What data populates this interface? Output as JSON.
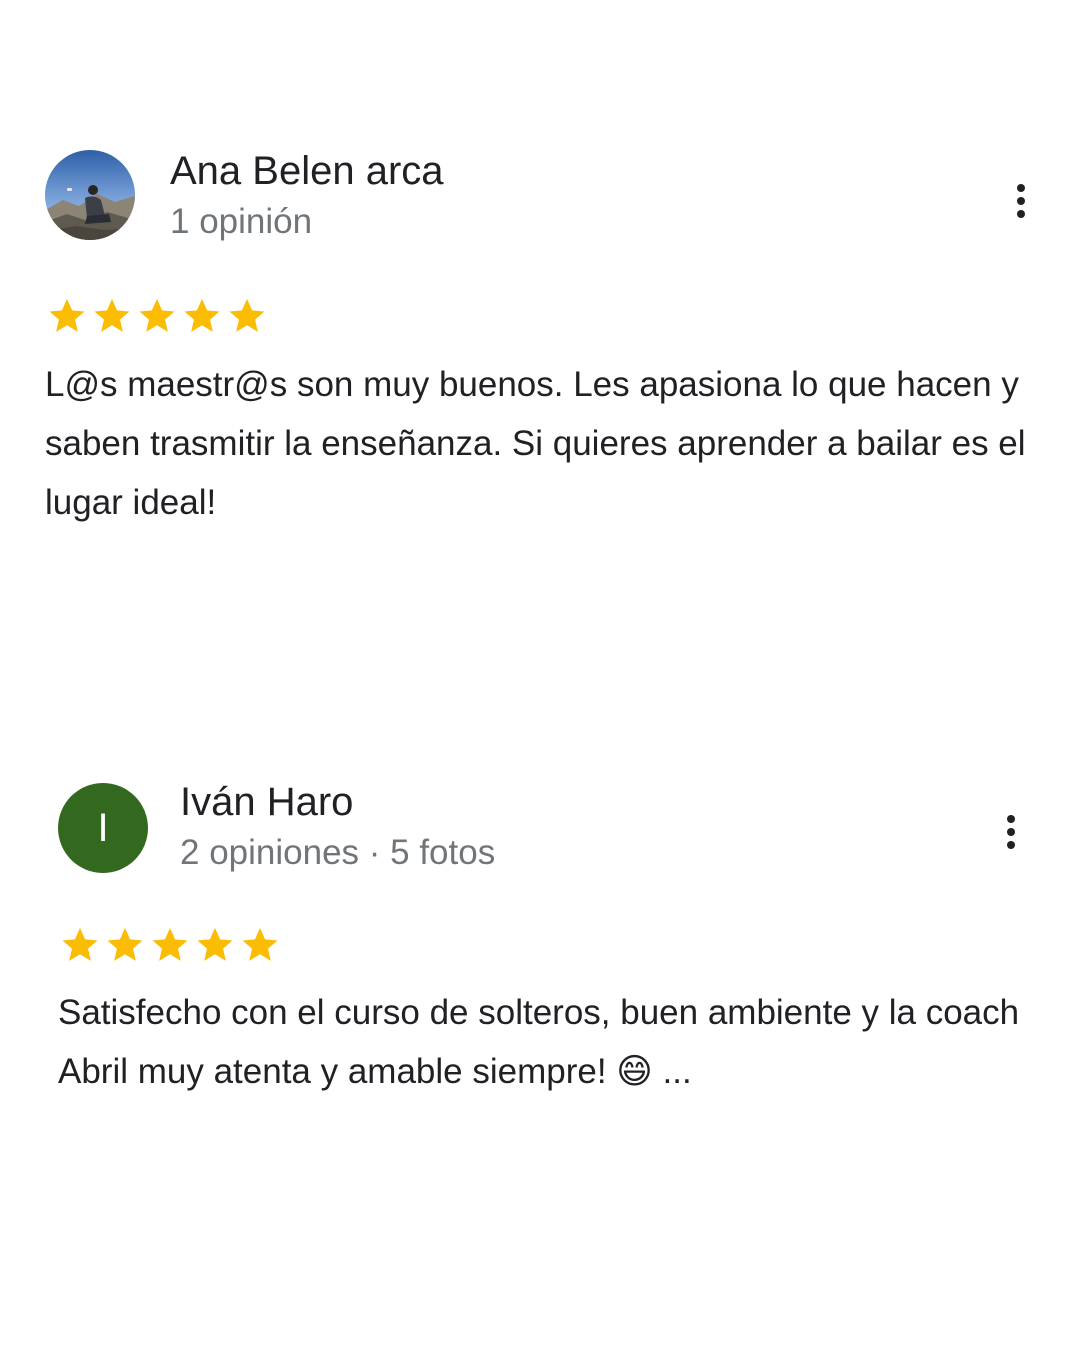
{
  "reviews": [
    {
      "author": "Ana Belen arca",
      "meta": "1 opinión",
      "rating": 5,
      "text": "L@s maestr@s son muy buenos. Les apasiona lo que hacen y saben trasmitir la enseñanza. Si quieres aprender a bailar es el lugar ideal!"
    },
    {
      "author": "Iván Haro",
      "avatar_letter": "I",
      "avatar_color": "#33691e",
      "meta": "2 opiniones · 5 fotos",
      "rating": 5,
      "text": "Satisfecho con el curso de solteros, buen ambiente y la coach Abril muy atenta y amable siempre! 😄 ..."
    }
  ],
  "colors": {
    "star": "#fbbc04",
    "author": "#202124",
    "meta": "#70757a"
  },
  "icons": {
    "more": "more-vert-icon",
    "star": "star-icon"
  }
}
